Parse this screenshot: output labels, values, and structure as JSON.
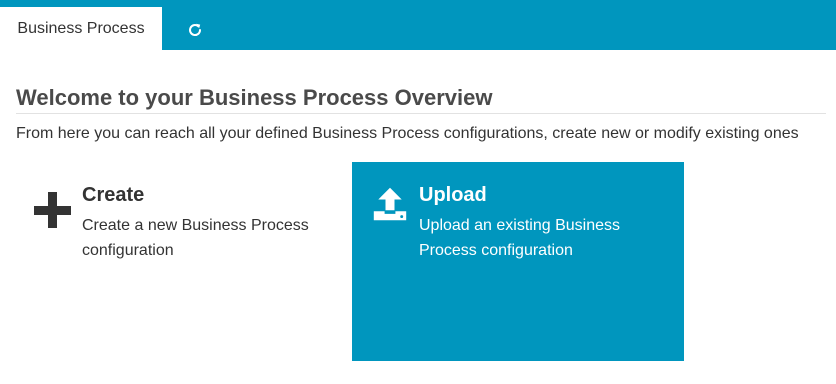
{
  "tabs": {
    "active_label": "Business Process",
    "refresh_icon": "refresh-icon"
  },
  "main": {
    "title": "Welcome to your Business Process Overview",
    "intro": "From here you can reach all your defined Business Process configurations, create new or modify existing ones"
  },
  "cards": {
    "create": {
      "icon": "plus-icon",
      "title": "Create",
      "description": "Create a new Business Process configuration"
    },
    "upload": {
      "icon": "upload-icon",
      "title": "Upload",
      "description": "Upload an existing Business Process configuration"
    }
  },
  "colors": {
    "accent": "#0096be",
    "text": "#333333",
    "title": "#4a4a4a"
  }
}
